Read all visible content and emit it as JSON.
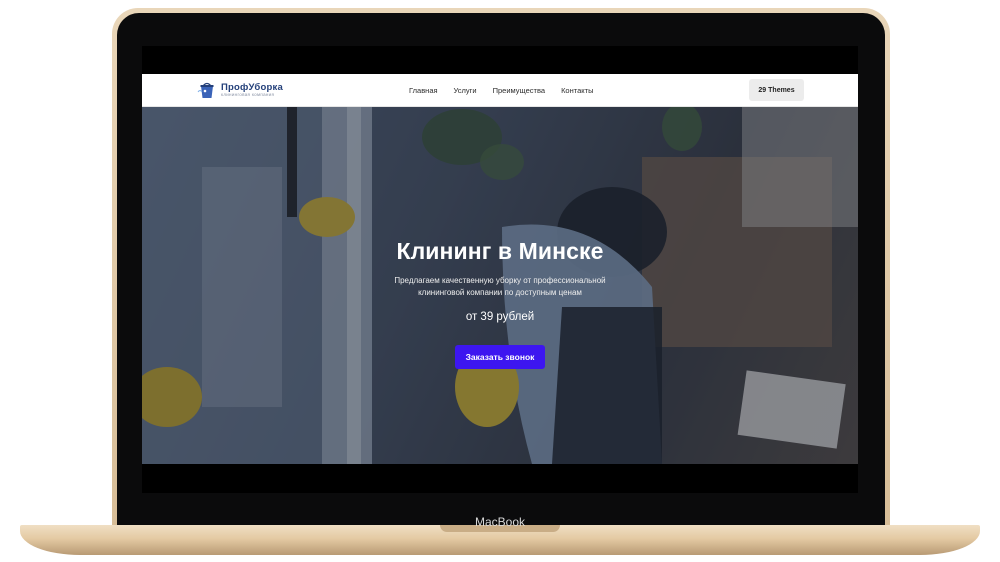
{
  "device": {
    "brand_label": "MacBook"
  },
  "header": {
    "logo_name": "ПрофУборка",
    "logo_tagline": "клининговая компания",
    "nav": [
      "Главная",
      "Услуги",
      "Преимущества",
      "Контакты"
    ],
    "themes_button": "29 Themes"
  },
  "hero": {
    "title": "Клининг в Минске",
    "subtitle_line1": "Предлагаем качественную уборку от профессиональной",
    "subtitle_line2": "клининговой компании по доступным ценам",
    "price": "от 39 рублей",
    "cta_label": "Заказать звонок"
  },
  "colors": {
    "accent": "#3d16f0",
    "logo": "#24407a",
    "laptop_gold": "#e4caa3"
  }
}
